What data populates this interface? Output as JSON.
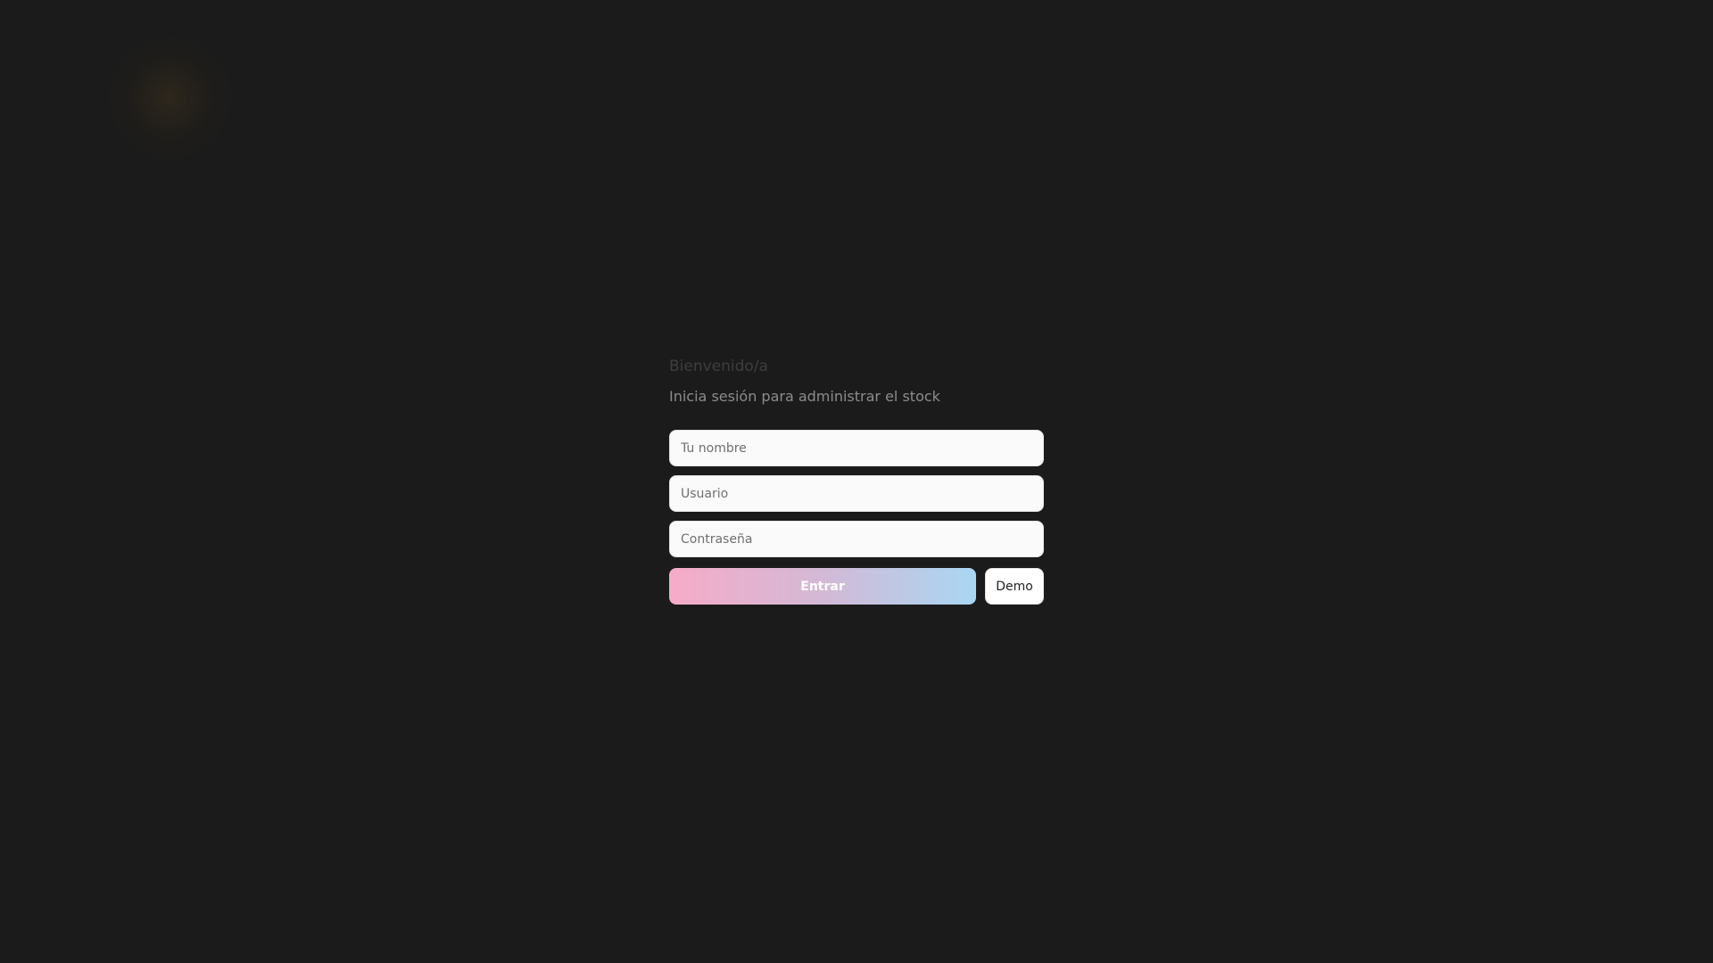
{
  "login": {
    "title": "Bienvenido/a",
    "subtitle": "Inicia sesión para administrar el stock",
    "fields": {
      "name_placeholder": "Tu nombre",
      "user_placeholder": "Usuario",
      "password_placeholder": "Contraseña"
    },
    "submit_label": "Entrar",
    "demo_label": "Demo"
  },
  "colors": {
    "background": "#1b1b1b",
    "gradient_start": "#f6abc8",
    "gradient_end": "#a9d7f3"
  }
}
